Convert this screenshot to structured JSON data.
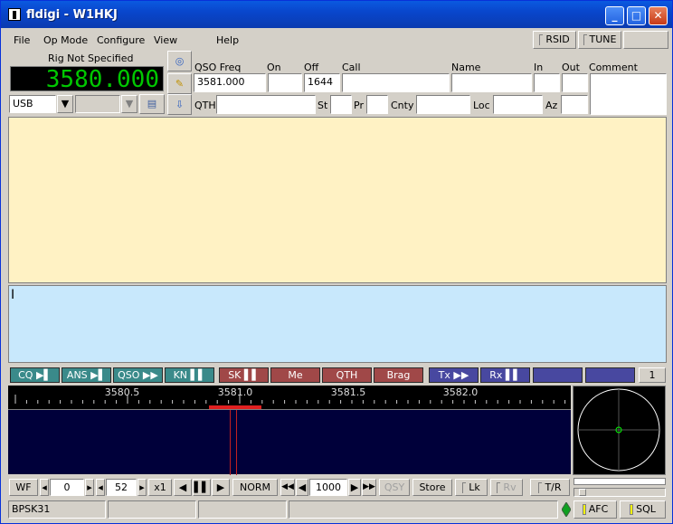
{
  "window": {
    "title": "fldigi - W1HKJ"
  },
  "menu": {
    "file": "File",
    "opmode": "Op Mode",
    "configure": "Configure",
    "view": "View",
    "help": "Help"
  },
  "toolbar": {
    "rsid": "RSID",
    "tune": "TUNE"
  },
  "rig": {
    "name": "Rig Not Specified",
    "freq": "3580.000",
    "mode": "USB"
  },
  "log": {
    "qso_freq_label": "QSO Freq",
    "qso_freq": "3581.000",
    "on_label": "On",
    "off_label": "Off",
    "off_value": "1644",
    "call_label": "Call",
    "name_label": "Name",
    "in_label": "In",
    "out_label": "Out",
    "comment_label": "Comment",
    "qth_label": "QTH",
    "st_label": "St",
    "pr_label": "Pr",
    "cnty_label": "Cnty",
    "loc_label": "Loc",
    "az_label": "Az"
  },
  "macros": [
    {
      "label": "CQ ▶▌",
      "color": "#3a8a8a"
    },
    {
      "label": "ANS ▶▌",
      "color": "#3a8a8a"
    },
    {
      "label": "QSO ▶▶",
      "color": "#3a8a8a"
    },
    {
      "label": "KN ▌▌",
      "color": "#3a8a8a"
    },
    {
      "label": "SK ▌▌",
      "color": "#a04848"
    },
    {
      "label": "Me",
      "color": "#a04848"
    },
    {
      "label": "QTH",
      "color": "#a04848"
    },
    {
      "label": "Brag",
      "color": "#a04848"
    },
    {
      "label": "Tx ▶▶",
      "color": "#4848a0"
    },
    {
      "label": "Rx ▌▌",
      "color": "#4848a0"
    },
    {
      "label": "",
      "color": "#4848a0"
    },
    {
      "label": "",
      "color": "#4848a0"
    }
  ],
  "macro_set": "1",
  "waterfall": {
    "scale_labels": [
      "3580.5",
      "3581.0",
      "3581.5",
      "3582.0"
    ]
  },
  "controls": {
    "wf": "WF",
    "offset": "0",
    "level": "52",
    "zoom": "x1",
    "norm": "NORM",
    "speed": "1000",
    "qsy": "QSY",
    "store": "Store",
    "lk": "Lk",
    "rv": "Rv",
    "tr": "T/R"
  },
  "status": {
    "mode": "BPSK31",
    "afc": "AFC",
    "sql": "SQL"
  }
}
